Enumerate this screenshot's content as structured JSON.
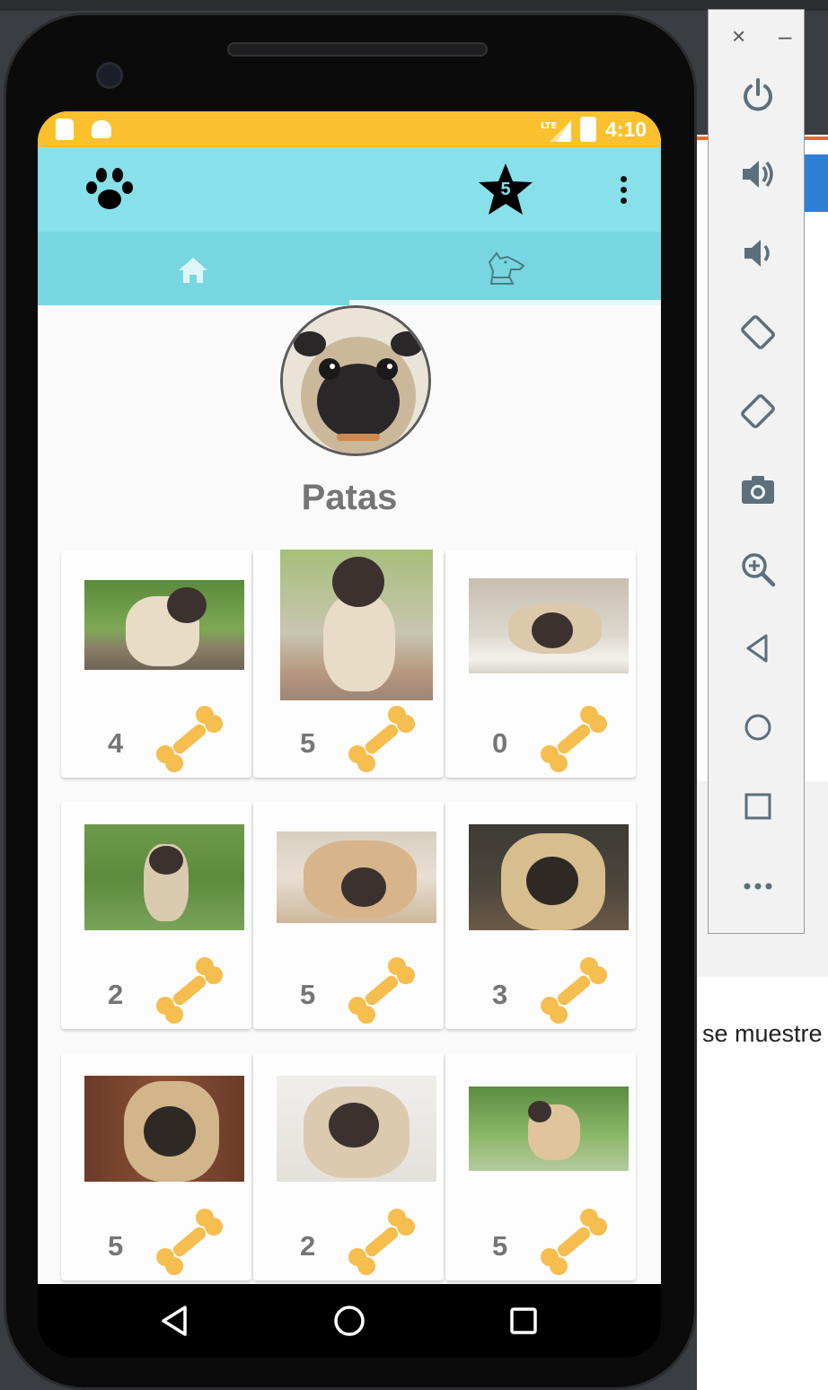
{
  "desktop": {
    "partial_text": "se muestre"
  },
  "status_bar": {
    "network": "LTE",
    "time": "4:10"
  },
  "app_bar": {
    "logo_icon": "paw-icon",
    "rating_icon": "star-icon",
    "rating_value": "5",
    "menu_icon": "more-vert-icon"
  },
  "tabs": [
    {
      "icon": "home-icon",
      "selected": false
    },
    {
      "icon": "dog-icon",
      "selected": true
    }
  ],
  "profile": {
    "name": "Patas"
  },
  "photos": [
    {
      "likes": "4"
    },
    {
      "likes": "5"
    },
    {
      "likes": "0"
    },
    {
      "likes": "2"
    },
    {
      "likes": "5"
    },
    {
      "likes": "3"
    },
    {
      "likes": "5"
    },
    {
      "likes": "2"
    },
    {
      "likes": "5"
    }
  ],
  "colors": {
    "status_bar": "#fbc02d",
    "app_bar": "#87e0ea",
    "tab_bar": "#77d6e0",
    "bone": "#f6bd4f",
    "likes_text": "#757575"
  },
  "emulator_toolbar": {
    "close": "×",
    "minimize": "–",
    "tools": [
      "power-icon",
      "volume-up-icon",
      "volume-down-icon",
      "rotate-left-icon",
      "rotate-right-icon",
      "camera-icon",
      "zoom-icon",
      "back-icon",
      "home-icon",
      "overview-icon",
      "more-icon"
    ]
  }
}
